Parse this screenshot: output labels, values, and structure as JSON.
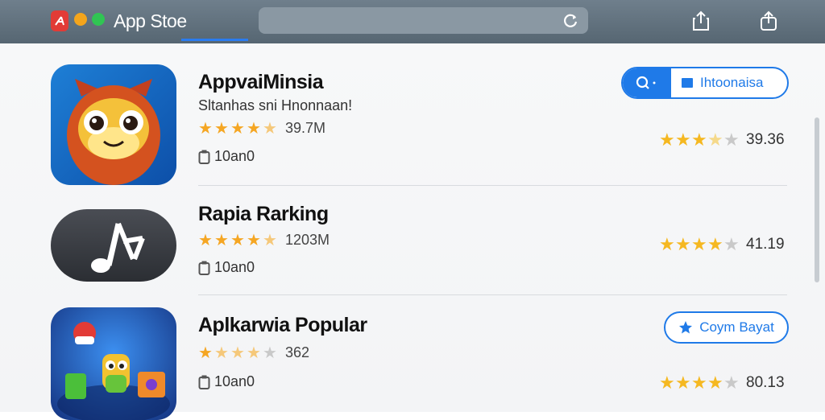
{
  "window": {
    "title": "App Stoe"
  },
  "apps": [
    {
      "name": "AppvaiMinsia",
      "subtitle": "Sltanhas sni Hnonnaan!",
      "rating_text": "39.7M",
      "size": "10an0",
      "right_rating": "39.36",
      "stars": 3
    },
    {
      "name": "Rapia Rarking",
      "subtitle": "",
      "rating_text": "1203M",
      "size": "10an0",
      "right_rating": "41.19",
      "stars": 4
    },
    {
      "name": "Aplkarwia Popular",
      "subtitle": "",
      "rating_text": "362",
      "size": "10an0",
      "right_rating": "80.13",
      "stars": 4
    }
  ],
  "search_pill": {
    "label": "Ihtoonaisa"
  },
  "action_pill": {
    "label": "Coym Bayat"
  },
  "colors": {
    "accent": "#1f7ae8",
    "star": "#f5a623",
    "topbar": "#5f6f7b",
    "close": "#e23b36",
    "minimize": "#f4a51c",
    "zoom": "#30c553"
  }
}
